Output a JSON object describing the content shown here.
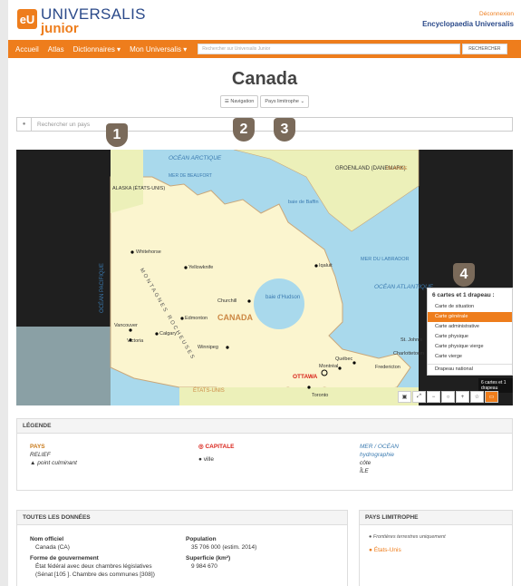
{
  "header": {
    "logo_badge": "eU",
    "logo_line1": "UNIVERSALIS",
    "logo_line2": "junior",
    "logout": "Déconnexion",
    "encyclopaedia": "Encyclopaedia Universalis"
  },
  "nav": {
    "items": [
      "Accueil",
      "Atlas",
      "Dictionnaires ▾",
      "Mon Universalis ▾"
    ],
    "search_placeholder": "Rechercher sur Universalis Junior",
    "search_button": "RECHERCHER"
  },
  "page_title": "Canada",
  "toolbar": {
    "navigation": "☰ Navigation",
    "pays": "Pays limitrophe ⌄"
  },
  "search": {
    "placeholder": "Rechercher un pays"
  },
  "badges": [
    "1",
    "2",
    "3",
    "4"
  ],
  "map": {
    "labels": {
      "ocean_arctique": "OCÉAN ARCTIQUE",
      "mer_beaufort": "MER DE BEAUFORT",
      "alaska": "ALASKA (ÉTATS-UNIS)",
      "groenland": "GROENLAND (DANEMARK)",
      "islande": "ISLANDE",
      "baie_baffin": "baie de Baffin",
      "mer_labrador": "MER DU LABRADOR",
      "ocean_atlantique": "OCÉAN ATLANTIQUE",
      "ocean_pacifique": "OCÉAN PACIFIQUE",
      "montagnes": "MONTAGNES ROCHEUSES",
      "canada": "CANADA",
      "baie_hudson": "baie d'Hudson",
      "etats_unis": "ÉTATS-UNIS",
      "ottawa": "OTTAWA"
    },
    "cities": [
      "Whitehorse",
      "Yellowknife",
      "Iqaluit",
      "Churchill",
      "Edmonton",
      "Calgary",
      "Vancouver",
      "Victoria",
      "Winnipeg",
      "Québec",
      "Montréal",
      "Toronto",
      "St. John's",
      "Charlottetown",
      "Fredericton"
    ],
    "menu_title": "6 cartes et 1 drapeau :",
    "menu_items": [
      "Carte de situation",
      "Carte générale",
      "Carte administrative",
      "Carte physique",
      "Carte physique vierge",
      "Carte vierge",
      "Drapeau national"
    ],
    "menu_active_index": 1,
    "tooltip": "6 cartes et 1 drapeau"
  },
  "legend": {
    "title": "LÉGENDE",
    "col1": [
      "PAYS",
      "RELIEF",
      "▲ point culminant"
    ],
    "col2": [
      "◎ CAPITALE",
      "● ville"
    ],
    "col3": [
      "MER / OCÉAN",
      "hydrographie",
      "côte",
      "ÎLE"
    ]
  },
  "data": {
    "title": "TOUTES LES DONNÉES",
    "official_label": "Nom officiel",
    "official_value": "Canada (CA)",
    "gov_label": "Forme de gouvernement",
    "gov_value1": "État fédéral avec deux chambres législatives",
    "gov_value2": "(Sénat [105 ]. Chambre des communes [308])",
    "pop_label": "Population",
    "pop_value": "35 706 000 (estim. 2014)",
    "area_label": "Superficie (km²)",
    "area_value": "9 984 670"
  },
  "limit": {
    "title": "PAYS LIMITROPHE",
    "note": "Frontières terrestres uniquement",
    "country": "États-Unis"
  },
  "colors": {
    "accent": "#ee7d1c",
    "brand": "#2b4a8a"
  }
}
